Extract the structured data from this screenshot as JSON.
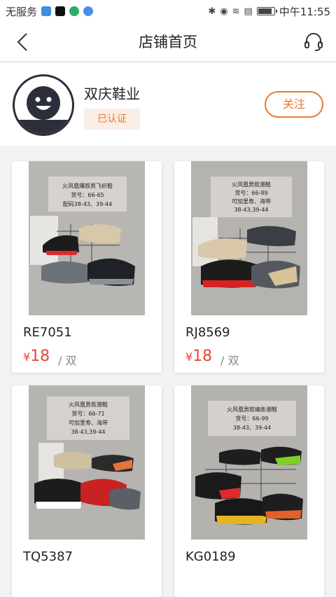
{
  "status_bar": {
    "carrier": "无服务",
    "time": "中午11:55",
    "battery_level": 0.92,
    "apps": [
      "shield-app",
      "tiktok-app",
      "wechat-app",
      "music-app"
    ]
  },
  "nav": {
    "title": "店铺首页",
    "back_icon": "chevron-left-icon",
    "service_icon": "headset-icon"
  },
  "shop": {
    "name": "双庆鞋业",
    "verified_label": "已认证",
    "follow_label": "关注"
  },
  "products": [
    {
      "code": "RE7051",
      "currency": "¥",
      "price": "18",
      "unit": "/ 双",
      "tag_text": "火凤凰爆版男飞织鞋\n货号：66-65\n配码38-43、39-44"
    },
    {
      "code": "RJ8569",
      "currency": "¥",
      "price": "18",
      "unit": "/ 双",
      "tag_text": "火凤凰男款潮鞋\n货号：66-89\n可加里寿、海带\n38-43,39-44"
    },
    {
      "code": "TQ5387",
      "currency": "¥",
      "price": "",
      "unit": "",
      "tag_text": "火凤凰男款潮鞋\n货号：66-71\n可加里寿、海带\n38-43,39-44"
    },
    {
      "code": "KG0189",
      "currency": "¥",
      "price": "",
      "unit": "",
      "tag_text": "火凤凰男款编条潮鞋\n货号：66-99\n38-43、39-44"
    }
  ],
  "colors": {
    "accent": "#e9792e",
    "price": "#e8483a",
    "badge_bg": "#fbeee4"
  }
}
